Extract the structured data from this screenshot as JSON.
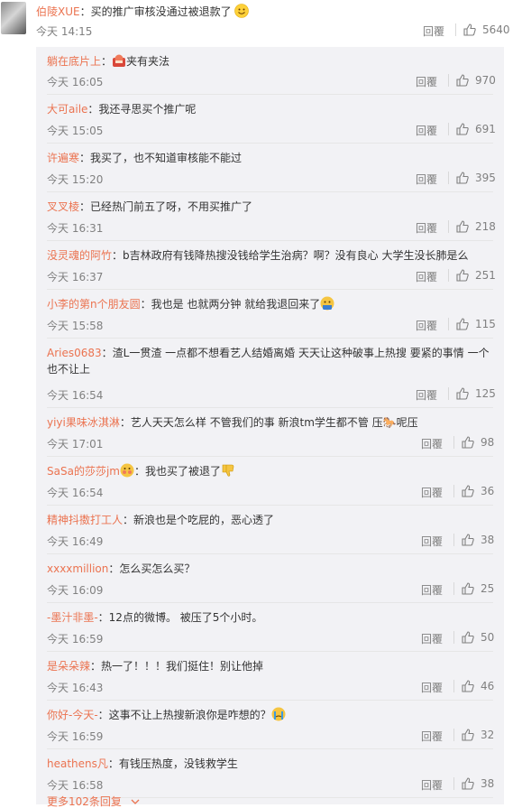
{
  "main_comment": {
    "user": "伯陵XUE",
    "text": "：买的推广审核没通过被退款了",
    "time": "今天 14:15",
    "reply_label": "回覆",
    "likes": "5640"
  },
  "replies": [
    {
      "user": "躺在底片上",
      "text": "夹有夹法",
      "time": "今天 16:05",
      "reply_label": "回覆",
      "likes": "970"
    },
    {
      "user": "大可aile",
      "text": "：我还寻思买个推广呢",
      "time": "今天 15:05",
      "reply_label": "回覆",
      "likes": "691"
    },
    {
      "user": "许遍寒",
      "text": "：我买了，也不知道审核能不能过",
      "time": "今天 15:20",
      "reply_label": "回覆",
      "likes": "395"
    },
    {
      "user": "叉叉棱",
      "text": "：已经热门前五了呀，不用买推广了",
      "time": "今天 16:31",
      "reply_label": "回覆",
      "likes": "218"
    },
    {
      "user": "没灵魂的阿竹",
      "text": "：b吉林政府有钱降热搜没钱给学生治病？啊？没有良心 大学生没长肺是么",
      "time": "今天 16:37",
      "reply_label": "回覆",
      "likes": "251"
    },
    {
      "user": "小李的第n个朋友圆",
      "text": "：我也是 也就两分钟 就给我退回来了",
      "time": "今天 15:58",
      "reply_label": "回覆",
      "likes": "115"
    },
    {
      "user": "Aries0683",
      "text": "：渣L一贯渣 一点都不想看艺人结婚离婚 天天让这种破事上热搜 要紧的事情 一个也不让上",
      "time": "今天 16:54",
      "reply_label": "回覆",
      "likes": "125"
    },
    {
      "user": "yiyi果味冰淇淋",
      "text": "：艺人天天怎么样 不管我们的事 新浪tm学生都不管 压🐎呢压",
      "time": "今天 17:01",
      "reply_label": "回覆",
      "likes": "98"
    },
    {
      "user": "SaSa的莎莎jm",
      "text": "：我也买了被退了",
      "time": "今天 16:54",
      "reply_label": "回覆",
      "likes": "36"
    },
    {
      "user": "精神抖擞打工人",
      "text": "：新浪也是个吃屁的，恶心透了",
      "time": "今天 16:49",
      "reply_label": "回覆",
      "likes": "38"
    },
    {
      "user": "xxxxmillion",
      "text": "：怎么买怎么买？",
      "time": "今天 16:09",
      "reply_label": "回覆",
      "likes": "25"
    },
    {
      "user": "-墨汁非墨-",
      "text": "：12点的微博。 被压了5个小时。",
      "time": "今天 16:59",
      "reply_label": "回覆",
      "likes": "50"
    },
    {
      "user": "是朵朵辣",
      "text": "：热一了！！！我们挺住！别让他掉",
      "time": "今天 16:43",
      "reply_label": "回覆",
      "likes": "46"
    },
    {
      "user": "你好-今天-",
      "text": "：这事不让上热搜新浪你是咋想的？",
      "time": "今天 16:59",
      "reply_label": "回覆",
      "likes": "32"
    },
    {
      "user": "heathens凡",
      "text": "：有钱压热度，没钱救学生",
      "time": "今天 16:58",
      "reply_label": "回覆",
      "likes": "38"
    }
  ],
  "more_replies": "更多102条回复",
  "icons": {
    "thumb": "thumbs-up-icon",
    "chevron": "chevron-down-icon"
  },
  "colors": {
    "username": "#eb7350",
    "meta": "#808080",
    "reply_bg": "#f2f2f5"
  }
}
